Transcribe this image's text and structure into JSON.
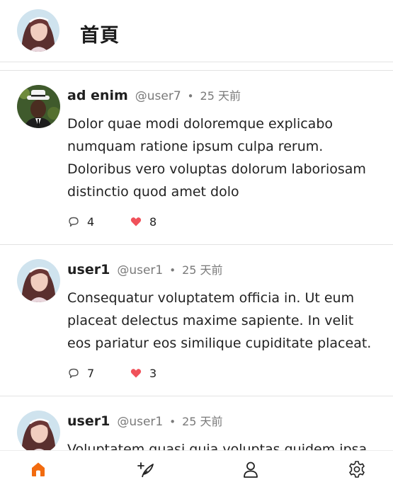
{
  "header": {
    "title": "首頁",
    "avatar_icon": "user-avatar-icon"
  },
  "posts": [
    {
      "name": "ad enim",
      "handle": "@user7",
      "separator": "•",
      "time": "25 天前",
      "text": "Dolor quae modi doloremque explicabo numquam ratione ipsum culpa rerum. Doloribus vero voluptas dolorum laboriosam distinctio quod amet dolo",
      "replies": "4",
      "likes": "8",
      "avatar_icon": "man-hat-avatar-icon"
    },
    {
      "name": "user1",
      "handle": "@user1",
      "separator": "•",
      "time": "25 天前",
      "text": "Consequatur voluptatem officia in. Ut eum placeat delectus maxime sapiente. In velit eos pariatur eos similique cupiditate placeat.",
      "replies": "7",
      "likes": "3",
      "avatar_icon": "woman-avatar-icon"
    },
    {
      "name": "user1",
      "handle": "@user1",
      "separator": "•",
      "time": "25 天前",
      "text": "Voluptatem quasi quia voluptas quidem ipsa",
      "avatar_icon": "woman-avatar-icon"
    }
  ],
  "tabbar": {
    "items": [
      "home-icon",
      "compose-icon",
      "profile-icon",
      "settings-icon"
    ],
    "active_color": "#f26b0f",
    "inactive_color": "#222222"
  },
  "colors": {
    "like": "#f0515a",
    "muted": "#7a7a7a",
    "divider": "#e3e3e3"
  }
}
